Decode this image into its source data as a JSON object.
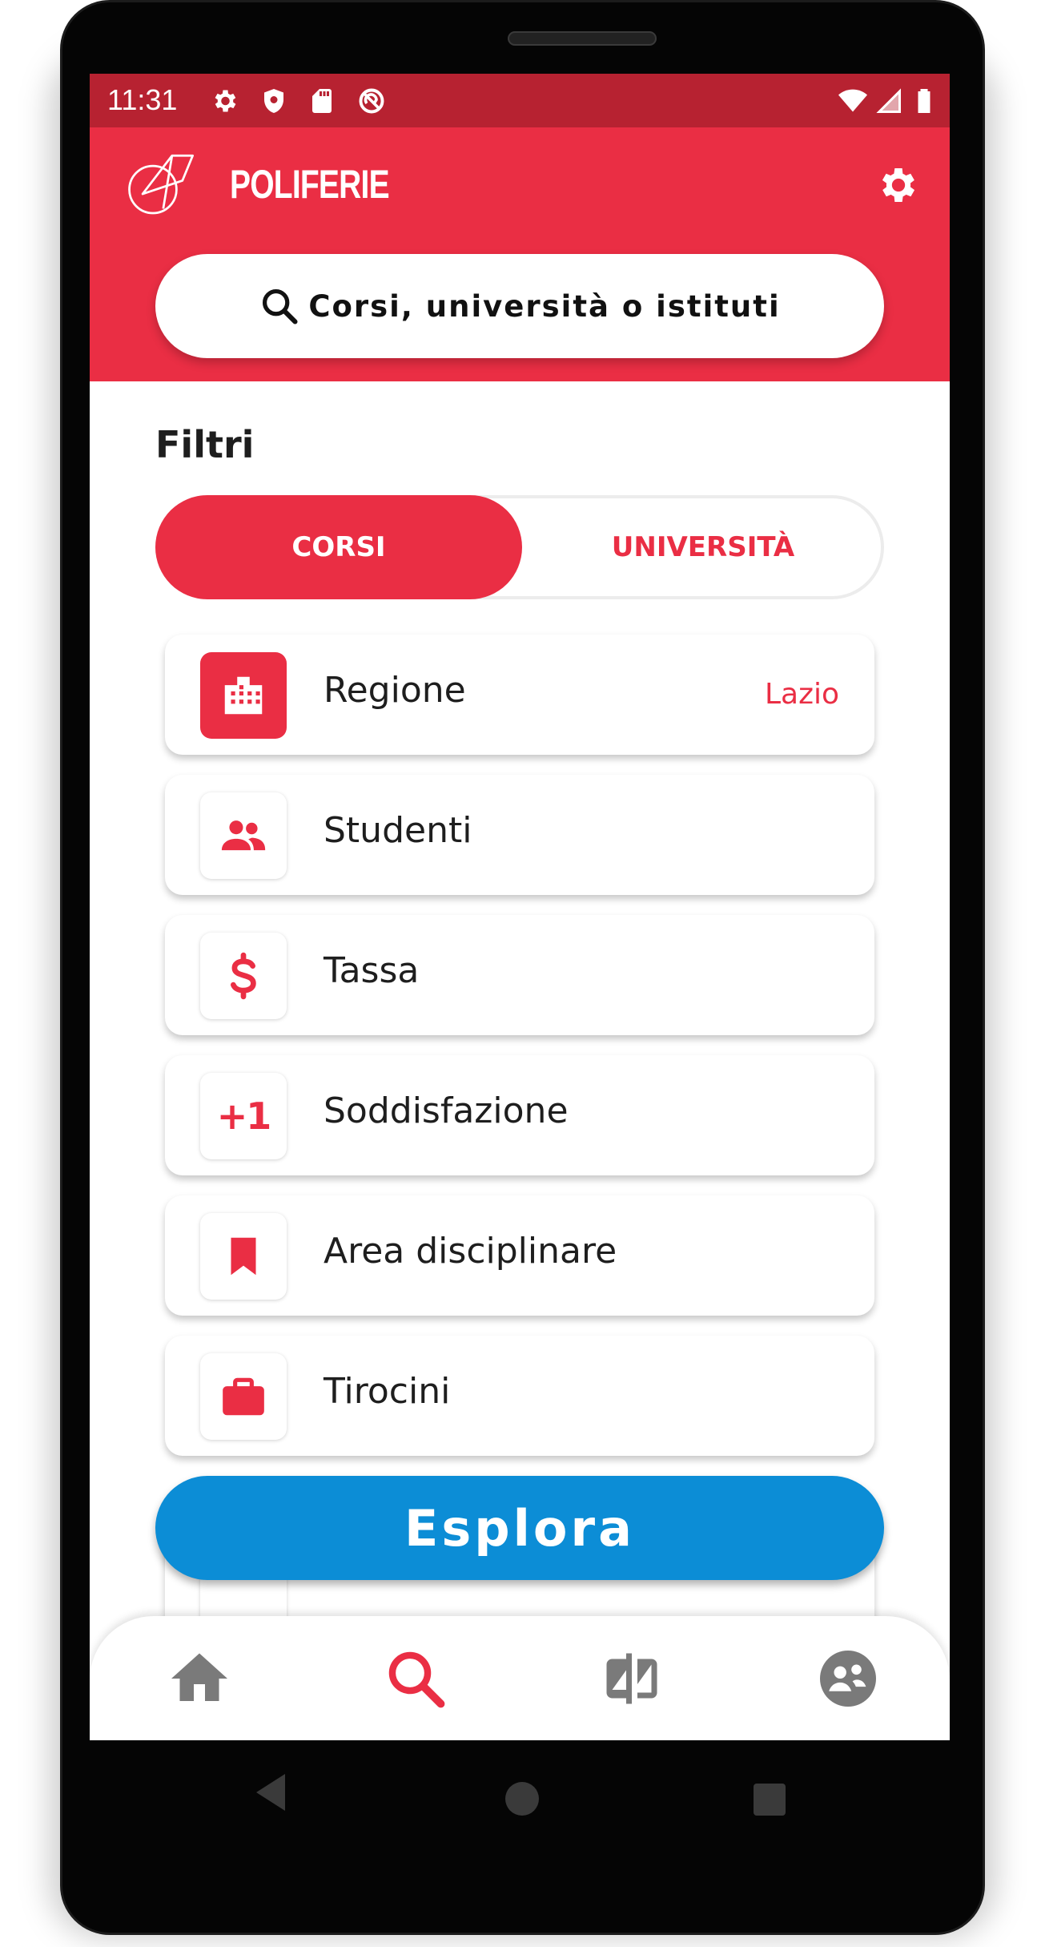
{
  "status_bar": {
    "time": "11:31"
  },
  "header": {
    "app_title": "POLIFERIE",
    "search_placeholder": "Corsi, università o istituti"
  },
  "filters": {
    "title": "Filtri",
    "tabs": [
      {
        "label": "CORSI",
        "selected": true
      },
      {
        "label": "UNIVERSITÀ",
        "selected": false
      }
    ],
    "items": [
      {
        "icon": "building-icon",
        "label": "Regione",
        "value": "Lazio",
        "active": true
      },
      {
        "icon": "people-icon",
        "label": "Studenti",
        "value": ""
      },
      {
        "icon": "dollar-icon",
        "label": "Tassa",
        "value": ""
      },
      {
        "icon": "plus-one-icon",
        "label": "Soddisfazione",
        "value": "",
        "glyph": "+1"
      },
      {
        "icon": "bookmark-icon",
        "label": "Area disciplinare",
        "value": ""
      },
      {
        "icon": "briefcase-icon",
        "label": "Tirocini",
        "value": ""
      }
    ]
  },
  "explore_button": {
    "label": "Esplora"
  },
  "bottom_nav": [
    {
      "icon": "home-icon",
      "active": false
    },
    {
      "icon": "search-icon",
      "active": true
    },
    {
      "icon": "compare-icon",
      "active": false
    },
    {
      "icon": "profile-icon",
      "active": false
    }
  ],
  "colors": {
    "primary": "#ea2e44",
    "status_bar": "#b72231",
    "explore": "#0c8dd6",
    "nav_inactive": "#7a7a7a"
  }
}
